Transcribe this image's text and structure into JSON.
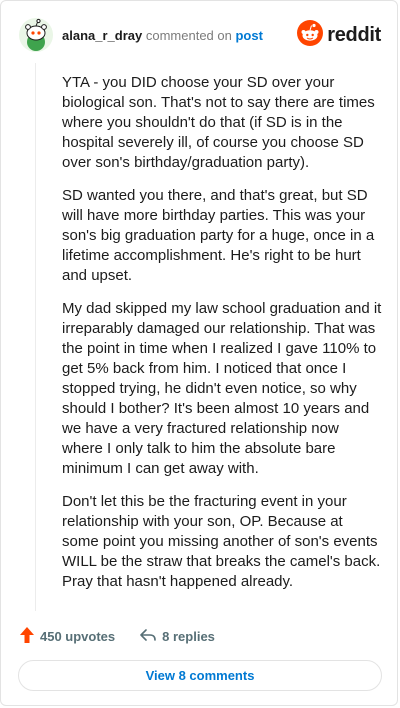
{
  "header": {
    "username": "alana_r_dray",
    "commented_text": "commented on",
    "post_link": "post",
    "brand": "reddit",
    "avatar_icon": "snoo-avatar-icon",
    "brand_icon": "reddit-logo-icon"
  },
  "comment": {
    "paragraphs": [
      "YTA - you DID choose your SD over your biological son. That's not to say there are times where you shouldn't do that (if SD is in the hospital severely ill, of course you choose SD over son's birthday/graduation party).",
      "SD wanted you there, and that's great, but SD will have more birthday parties. This was your son's big graduation party for a huge, once in a lifetime accomplishment. He's right to be hurt and upset.",
      "My dad skipped my law school graduation and it irreparably damaged our relationship. That was the point in time when I realized I gave 110% to get 5% back from him. I noticed that once I stopped trying, he didn't even notice, so why should I bother? It's been almost 10 years and we have a very fractured relationship now where I only talk to him the absolute bare minimum I can get away with.",
      "Don't let this be the fracturing event in your relationship with your son, OP. Because at some point you missing another of son's events WILL be the straw that breaks the camel's back. Pray that hasn't happened already."
    ]
  },
  "actions": {
    "upvotes": "450 upvotes",
    "replies": "8 replies",
    "view_comments": "View 8 comments"
  },
  "colors": {
    "upvote": "#ff4500",
    "link": "#0079d3",
    "brand": "#ff4500"
  }
}
